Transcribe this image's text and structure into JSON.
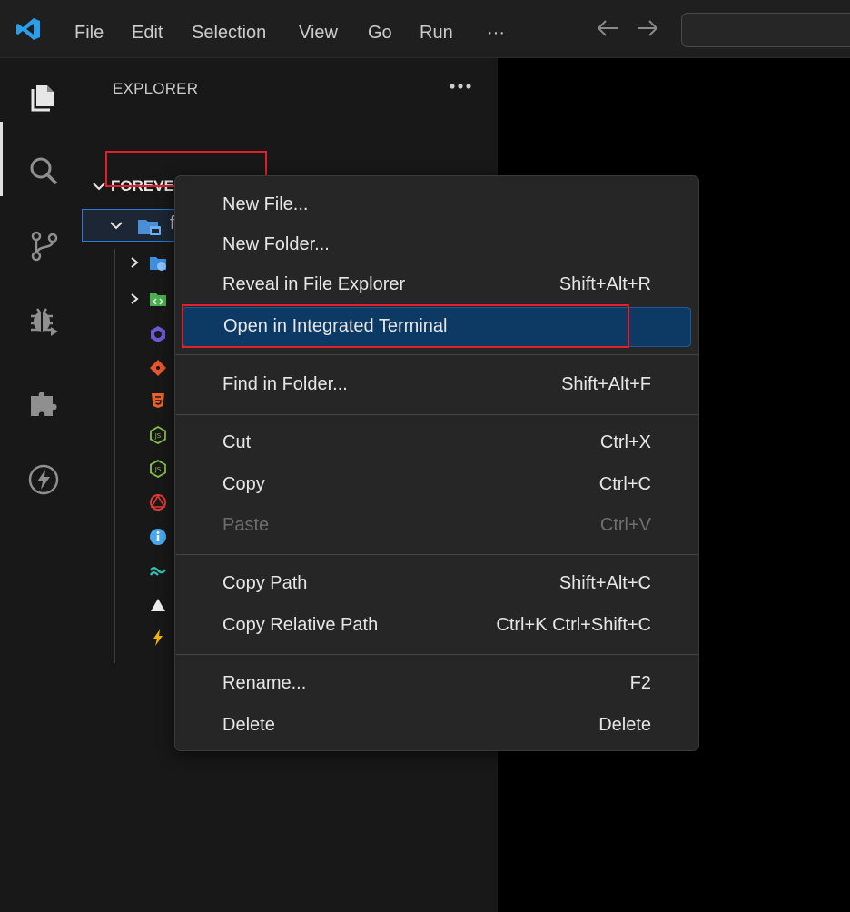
{
  "menubar": {
    "items": [
      "File",
      "Edit",
      "Selection",
      "View",
      "Go",
      "Run",
      "···"
    ]
  },
  "icons": {
    "logo": "vscode-logo-icon",
    "back": "arrow-left-icon",
    "forward": "arrow-right-icon",
    "activity": [
      "explorer-icon",
      "search-icon",
      "source-control-icon",
      "run-debug-icon",
      "extensions-icon",
      "lightning-icon"
    ]
  },
  "explorer": {
    "title": "EXPLORER",
    "more": "•••",
    "section": "FOREVER",
    "folder": "frontend"
  },
  "context_menu": {
    "items": [
      {
        "label": "New File...",
        "key": ""
      },
      {
        "label": "New Folder...",
        "key": ""
      },
      {
        "label": "Reveal in File Explorer",
        "key": "Shift+Alt+R"
      },
      {
        "label": "Open in Integrated Terminal",
        "key": ""
      },
      {
        "label": "Find in Folder...",
        "key": "Shift+Alt+F"
      },
      {
        "label": "Cut",
        "key": "Ctrl+X"
      },
      {
        "label": "Copy",
        "key": "Ctrl+C"
      },
      {
        "label": "Paste",
        "key": "Ctrl+V"
      },
      {
        "label": "Copy Path",
        "key": "Shift+Alt+C"
      },
      {
        "label": "Copy Relative Path",
        "key": "Ctrl+K Ctrl+Shift+C"
      },
      {
        "label": "Rename...",
        "key": "F2"
      },
      {
        "label": "Delete",
        "key": "Delete"
      }
    ]
  },
  "colors": {
    "accent": "#0078d4",
    "highlight_bg": "#0d3a64",
    "annotation_red": "#e0202a"
  }
}
